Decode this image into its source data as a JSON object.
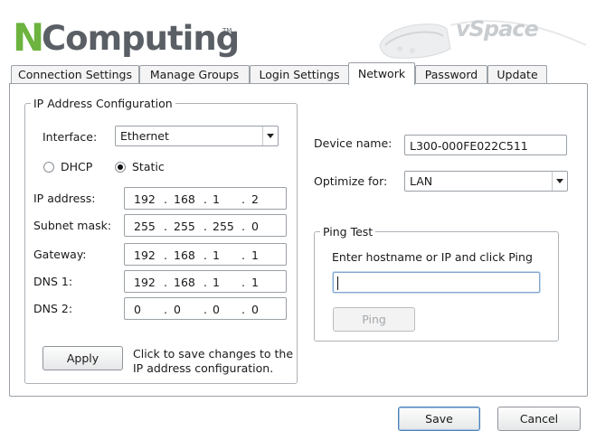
{
  "header": {
    "logo_n": "N",
    "logo_rest": "Computing",
    "logo_tm": "TM",
    "product_name": "vSpace"
  },
  "tabs": [
    {
      "label": "Connection Settings",
      "active": false
    },
    {
      "label": "Manage Groups",
      "active": false
    },
    {
      "label": "Login Settings",
      "active": false
    },
    {
      "label": "Network",
      "active": true
    },
    {
      "label": "Password",
      "active": false
    },
    {
      "label": "Update",
      "active": false
    }
  ],
  "ip_config": {
    "legend": "IP Address Configuration",
    "interface_label": "Interface:",
    "interface_value": "Ethernet",
    "dhcp_label": "DHCP",
    "static_label": "Static",
    "mode_selected": "Static",
    "ip_address": {
      "label": "IP address:",
      "octets": [
        "192",
        "168",
        "1",
        "2"
      ]
    },
    "subnet_mask": {
      "label": "Subnet mask:",
      "octets": [
        "255",
        "255",
        "255",
        "0"
      ]
    },
    "gateway": {
      "label": "Gateway:",
      "octets": [
        "192",
        "168",
        "1",
        "1"
      ]
    },
    "dns1": {
      "label": "DNS 1:",
      "octets": [
        "192",
        "168",
        "1",
        "1"
      ]
    },
    "dns2": {
      "label": "DNS 2:",
      "octets": [
        "0",
        "0",
        "0",
        "0"
      ]
    },
    "apply_label": "Apply",
    "apply_hint_line1": "Click to save changes to the",
    "apply_hint_line2": "IP address configuration."
  },
  "device": {
    "name_label": "Device name:",
    "name_value": "L300-000FE022C511",
    "optimize_label": "Optimize for:",
    "optimize_value": "LAN"
  },
  "ping": {
    "legend": "Ping Test",
    "instruction": "Enter hostname or IP and click Ping",
    "input_value": "",
    "button_label": "Ping",
    "button_enabled": false
  },
  "footer": {
    "save_label": "Save",
    "cancel_label": "Cancel"
  },
  "colors": {
    "brand_green": "#6cb33f",
    "brand_gray": "#5a5f66",
    "border": "#9aa0a6"
  }
}
